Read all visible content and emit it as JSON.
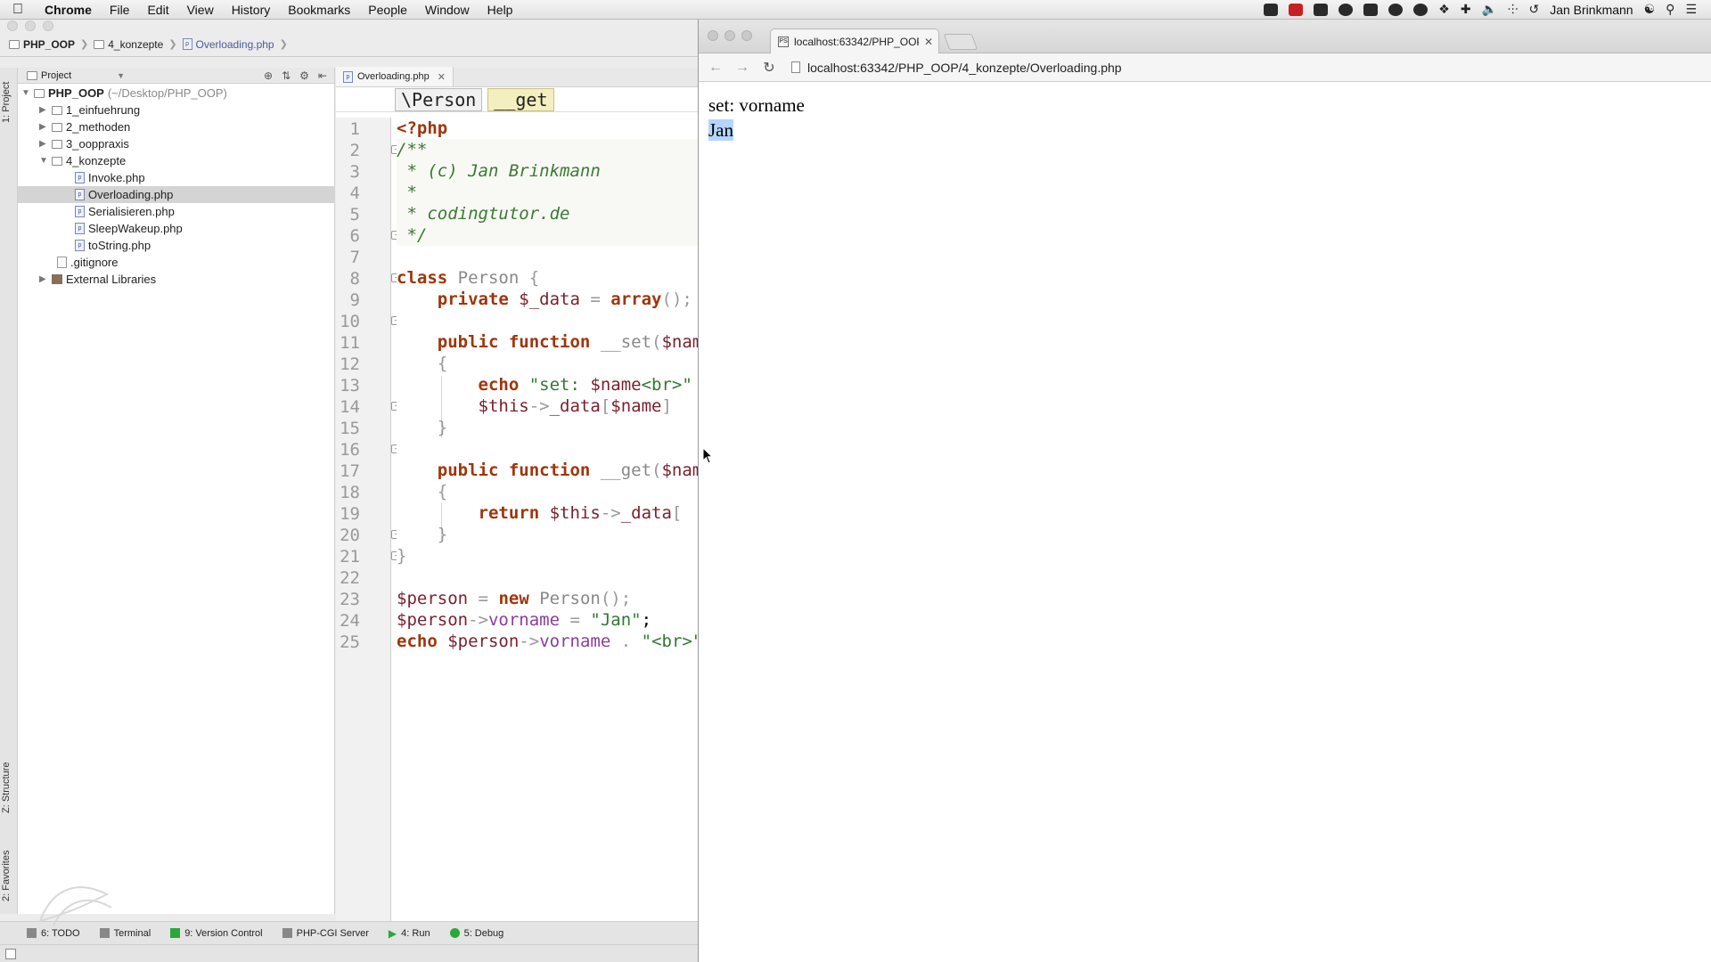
{
  "menubar": {
    "app": "Chrome",
    "items": [
      "File",
      "Edit",
      "View",
      "History",
      "Bookmarks",
      "People",
      "Window",
      "Help"
    ],
    "user": "Jan Brinkmann"
  },
  "ide": {
    "breadcrumb": [
      "PHP_OOP",
      "4_konzepte",
      "Overloading.php"
    ],
    "project_dropdown": "Project",
    "tree": [
      {
        "label": "PHP_OOP",
        "extra": "(~/Desktop/PHP_OOP)"
      },
      {
        "label": "1_einfuehrung"
      },
      {
        "label": "2_methoden"
      },
      {
        "label": "3_ooppraxis"
      },
      {
        "label": "4_konzepte"
      },
      {
        "label": "Invoke.php"
      },
      {
        "label": "Overloading.php"
      },
      {
        "label": "Serialisieren.php"
      },
      {
        "label": "SleepWakeup.php"
      },
      {
        "label": "toString.php"
      },
      {
        "label": ".gitignore"
      },
      {
        "label": "External Libraries"
      }
    ],
    "editor_tab": "Overloading.php",
    "code_breadcrumb": [
      "\\Person",
      "__get"
    ],
    "line_numbers": [
      "1",
      "2",
      "3",
      "4",
      "5",
      "6",
      "7",
      "8",
      "9",
      "10",
      "11",
      "12",
      "13",
      "14",
      "15",
      "16",
      "17",
      "18",
      "19",
      "20",
      "21",
      "22",
      "23",
      "24",
      "25"
    ],
    "side_tabs": [
      "1: Project",
      "Z: Structure",
      "2: Favorites"
    ],
    "bottom_tools": [
      "6: TODO",
      "Terminal",
      "9: Version Control",
      "PHP-CGI Server",
      "4: Run",
      "5: Debug"
    ]
  },
  "chrome": {
    "tab_title": "localhost:63342/PHP_OOP",
    "url": "localhost:63342/PHP_OOP/4_konzepte/Overloading.php",
    "output_lines": [
      "set: vorname",
      "Jan"
    ]
  },
  "colors": {
    "keyword": "#a0350c",
    "comment": "#3b7a32",
    "selection": "#b5d5ff",
    "breadcrumb_active": "#f3efbf"
  }
}
